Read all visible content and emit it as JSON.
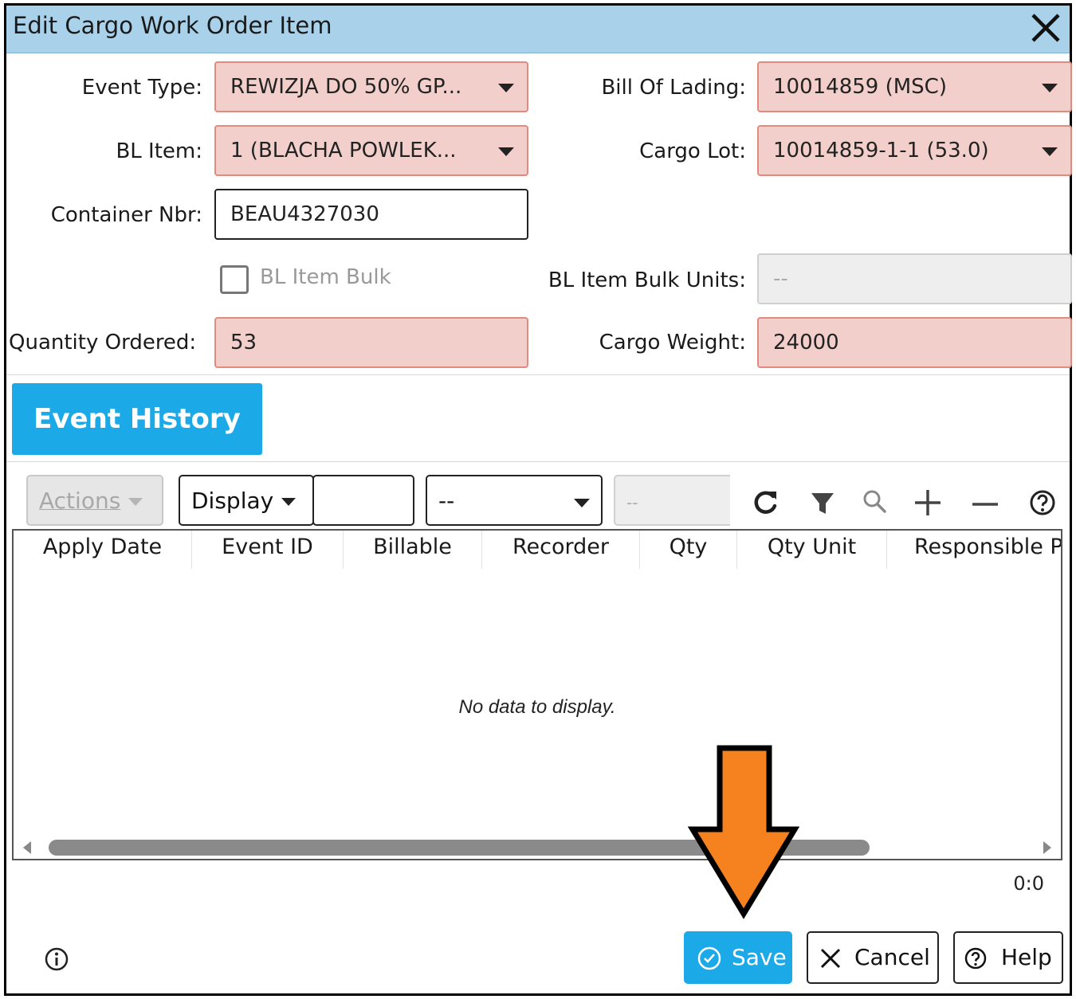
{
  "dialog": {
    "title": "Edit Cargo Work Order Item"
  },
  "form": {
    "event_type": {
      "label": "Event Type:",
      "value": "REWIZJA DO 50% GP..."
    },
    "bill_of_lading": {
      "label": "Bill Of Lading:",
      "value": "10014859 (MSC)"
    },
    "bl_item": {
      "label": "BL Item:",
      "value": "1 (BLACHA POWLEK..."
    },
    "cargo_lot": {
      "label": "Cargo Lot:",
      "value": "10014859-1-1 (53.0)"
    },
    "container_nbr": {
      "label": "Container Nbr:",
      "value": "BEAU4327030"
    },
    "bl_item_bulk": {
      "label": "BL Item Bulk",
      "checked": false
    },
    "bl_item_bulk_units": {
      "label": "BL Item Bulk Units:",
      "value": "--"
    },
    "quantity_ordered": {
      "label": "Quantity Ordered:",
      "value": "53"
    },
    "cargo_weight": {
      "label": "Cargo Weight:",
      "value": "24000"
    }
  },
  "event_history": {
    "tab_label": "Event History",
    "toolbar": {
      "actions_label": "Actions",
      "display_label": "Display",
      "display_input_value": "",
      "filter_select_value": "--",
      "filter_value": "--"
    },
    "columns": [
      "Apply Date",
      "Event ID",
      "Billable",
      "Recorder",
      "Qty",
      "Qty Unit",
      "Responsible P"
    ],
    "empty_message": "No data to display.",
    "counter": "0:0"
  },
  "footer": {
    "save_label": "Save",
    "cancel_label": "Cancel",
    "help_label": "Help"
  },
  "colors": {
    "titlebar": "#a9d1ea",
    "required_field_bg": "#f2cfcb",
    "required_field_border": "#e08a80",
    "accent": "#1ca9e8",
    "annotation_arrow": "#f5821f"
  }
}
